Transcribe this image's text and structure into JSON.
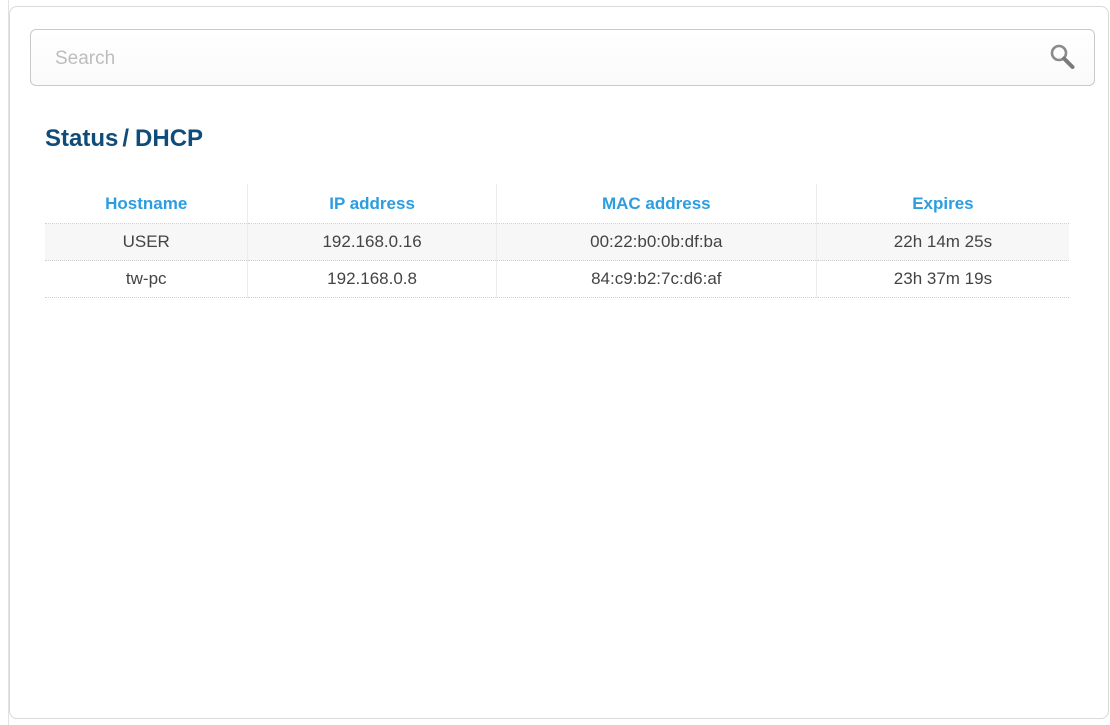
{
  "search": {
    "placeholder": "Search",
    "value": "",
    "icon": "search-icon"
  },
  "breadcrumb": {
    "section": "Status",
    "separator": "/",
    "page": "DHCP"
  },
  "table": {
    "columns": [
      "Hostname",
      "IP address",
      "MAC address",
      "Expires"
    ],
    "rows": [
      [
        "USER",
        "192.168.0.16",
        "00:22:b0:0b:df:ba",
        "22h 14m 25s"
      ],
      [
        "tw-pc",
        "192.168.0.8",
        "84:c9:b2:7c:d6:af",
        "23h 37m 19s"
      ]
    ]
  },
  "colors": {
    "title": "#0f4c7a",
    "header_text": "#2b9de0",
    "cell_text": "#444444"
  }
}
